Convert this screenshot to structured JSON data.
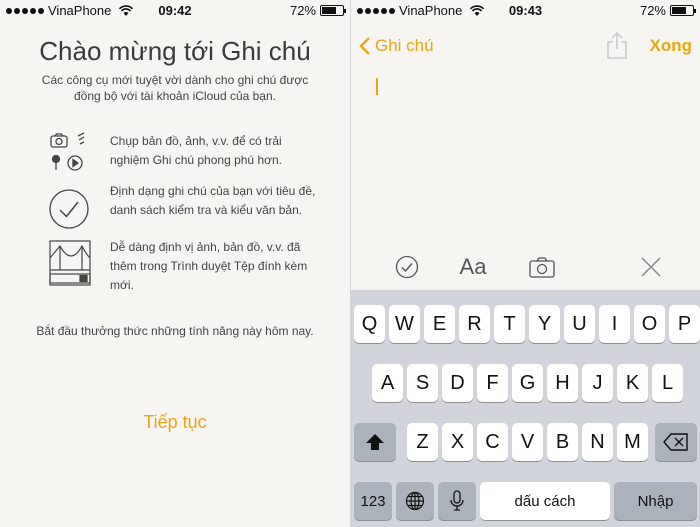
{
  "left": {
    "status": {
      "carrier": "VinaPhone",
      "time": "09:42",
      "battery": "72%",
      "battery_level": 0.72
    },
    "title": "Chào mừng tới Ghi chú",
    "subtitle": "Các công cụ mới tuyệt vời dành cho ghi chú được đồng bộ với tài khoản iCloud của bạn.",
    "features": [
      {
        "icon": "camera-sketch-map-icons",
        "text": "Chụp bản đồ, ảnh, v.v. để có trải nghiệm Ghi chú phong phú hơn."
      },
      {
        "icon": "checkmark-circle-icon",
        "text": "Định dạng ghi chú của bạn với tiêu đề, danh sách kiểm tra và kiểu văn bản."
      },
      {
        "icon": "bridge-attachment-icon",
        "text": "Dễ dàng định vị ảnh, bản đồ, v.v. đã thêm trong Trình duyệt Tệp đính kèm mới."
      }
    ],
    "start_text": "Bắt đầu thưởng thức những tính năng này hôm nay.",
    "continue_label": "Tiếp tục"
  },
  "right": {
    "status": {
      "carrier": "VinaPhone",
      "time": "09:43",
      "battery": "72%",
      "battery_level": 0.72
    },
    "nav": {
      "back_label": "Ghi chú",
      "done_label": "Xong"
    },
    "toolbar": {
      "format_label": "Aa",
      "icons": [
        "checklist-icon",
        "text-format-icon",
        "camera-icon",
        "close-icon"
      ]
    },
    "keyboard": {
      "row1": [
        "Q",
        "W",
        "E",
        "R",
        "T",
        "Y",
        "U",
        "I",
        "O",
        "P"
      ],
      "row2": [
        "A",
        "S",
        "D",
        "F",
        "G",
        "H",
        "J",
        "K",
        "L"
      ],
      "row3": [
        "Z",
        "X",
        "C",
        "V",
        "B",
        "N",
        "M"
      ],
      "numbers_label": "123",
      "space_label": "dấu cách",
      "return_label": "Nhập"
    }
  },
  "colors": {
    "accent": "#e8a711",
    "keyboard_bg": "#d1d4da",
    "key_dark": "#acb2bc"
  }
}
